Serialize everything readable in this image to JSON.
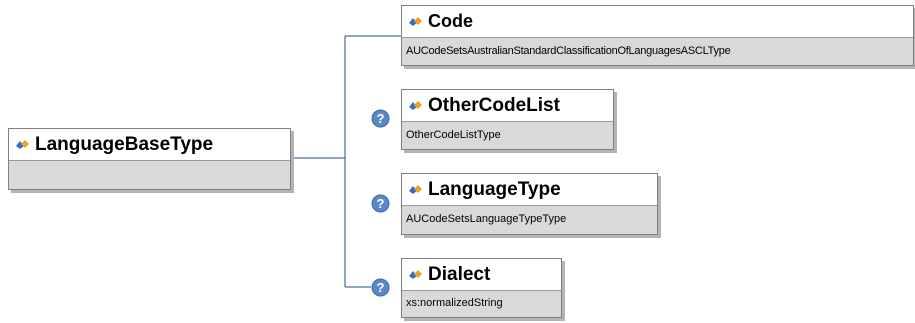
{
  "root": {
    "name": "LanguageBaseType",
    "icon": "element-icon"
  },
  "children": [
    {
      "name": "Code",
      "type": "AUCodeSetsAustralianStandardClassificationOfLanguagesASCLType",
      "optional": false,
      "icon": "element-icon"
    },
    {
      "name": "OtherCodeList",
      "type": "OtherCodeListType",
      "optional": true,
      "icon": "element-icon"
    },
    {
      "name": "LanguageType",
      "type": "AUCodeSetsLanguageTypeType",
      "optional": true,
      "icon": "element-icon"
    },
    {
      "name": "Dialect",
      "type": "xs:normalizedString",
      "optional": true,
      "icon": "element-icon"
    }
  ],
  "optional_marker": "?",
  "colors": {
    "icon_blue": "#2f6fcf",
    "icon_orange": "#f0a020",
    "connector": "#1f4e8c",
    "optional_badge": "#5a87c5",
    "type_row": "#d9d9d9"
  }
}
